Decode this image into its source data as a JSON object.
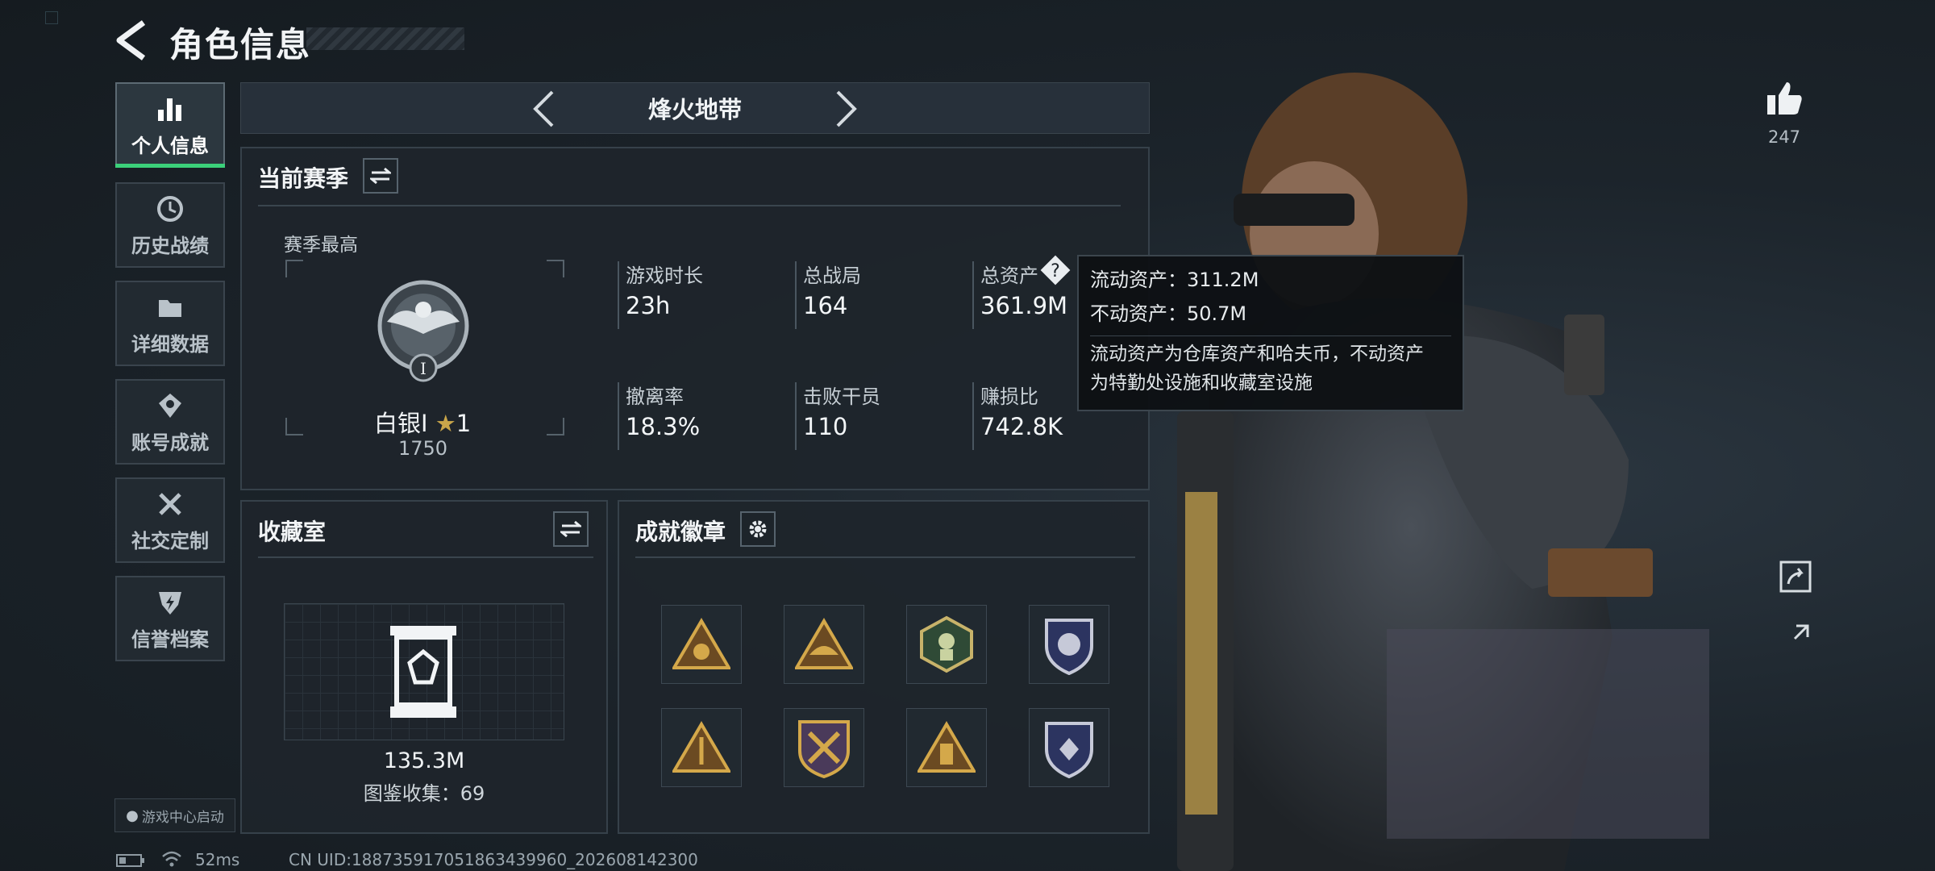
{
  "header": {
    "title": "角色信息"
  },
  "sidebar": {
    "items": [
      {
        "label": "个人信息",
        "icon": "bar-chart-icon"
      },
      {
        "label": "历史战绩",
        "icon": "clock-icon"
      },
      {
        "label": "详细数据",
        "icon": "folder-icon"
      },
      {
        "label": "账号成就",
        "icon": "achievement-icon"
      },
      {
        "label": "社交定制",
        "icon": "tools-icon"
      },
      {
        "label": "信誉档案",
        "icon": "shield-icon"
      }
    ]
  },
  "map_selector": {
    "name": "烽火地带"
  },
  "season": {
    "title": "当前赛季",
    "best_label": "赛季最高",
    "rank_name": "白银I",
    "rank_stars": "1",
    "rank_points": "1750",
    "rank_badge_numeral": "I",
    "stats": [
      {
        "label": "游戏时长",
        "value": "23h"
      },
      {
        "label": "总战局",
        "value": "164"
      },
      {
        "label": "总资产",
        "value": "361.9M"
      },
      {
        "label": "撤离率",
        "value": "18.3%"
      },
      {
        "label": "击败干员",
        "value": "110"
      },
      {
        "label": "赚损比",
        "value": "742.8K"
      }
    ]
  },
  "tooltip": {
    "liquid": "流动资产：311.2M",
    "fixed": "不动资产：50.7M",
    "desc1": "流动资产为仓库资产和哈夫币，不动资产",
    "desc2": "为特勤处设施和收藏室设施"
  },
  "collection": {
    "title": "收藏室",
    "value": "135.3M",
    "catalog": "图鉴收集：69"
  },
  "achievements": {
    "title": "成就徽章"
  },
  "likes": {
    "count": "247"
  },
  "footer": {
    "game_center": "游戏中心启动",
    "ping": "52ms",
    "uid": "CN UID:188735917051863439960_202608142300"
  },
  "colors": {
    "accent_green": "#3bd07a",
    "gold": "#c9a64a"
  }
}
